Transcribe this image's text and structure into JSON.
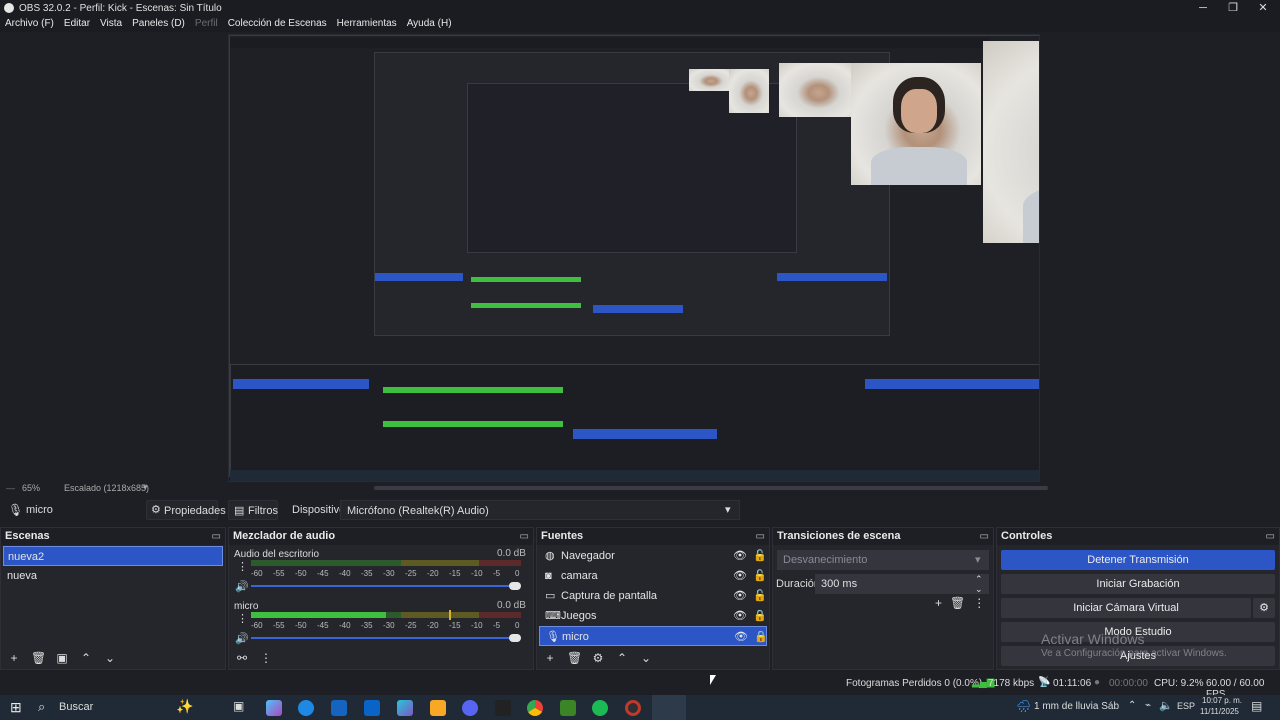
{
  "window": {
    "title": "OBS 32.0.2 - Perfil: Kick - Escenas: Sin Título",
    "controls": {
      "minimize": "─",
      "maximize": "❐",
      "close": "✕"
    }
  },
  "menu": {
    "items": [
      "Archivo (F)",
      "Editar",
      "Vista",
      "Paneles (D)",
      "Perfil",
      "Colección de Escenas",
      "Herramientas",
      "Ayuda (H)"
    ]
  },
  "scale": {
    "zoom": "65%",
    "scaled_label": "Escalado (1218x685)"
  },
  "properties_bar": {
    "source_name": "micro",
    "properties_label": "Propiedades",
    "filters_label": "Filtros",
    "device_label": "Dispositivo",
    "device_value": "Micrófono (Realtek(R) Audio)"
  },
  "scenes": {
    "header": "Escenas",
    "items": [
      "nueva2",
      "nueva"
    ],
    "selected": "nueva2"
  },
  "mixer": {
    "header": "Mezclador de audio",
    "channels": [
      {
        "name": "Audio del escritorio",
        "db": "0.0 dB",
        "level": 0.0
      },
      {
        "name": "micro",
        "db": "0.0 dB",
        "level": 0.5
      }
    ],
    "ticks": [
      "-60",
      "-55",
      "-50",
      "-45",
      "-40",
      "-35",
      "-30",
      "-25",
      "-20",
      "-15",
      "-10",
      "-5",
      "0"
    ]
  },
  "sources": {
    "header": "Fuentes",
    "items": [
      {
        "name": "Navegador",
        "icon": "globe-icon",
        "locked": false
      },
      {
        "name": "camara",
        "icon": "camera-icon",
        "locked": false
      },
      {
        "name": "Captura de pantalla",
        "icon": "monitor-icon",
        "locked": false
      },
      {
        "name": "Juegos",
        "icon": "gamepad-icon",
        "locked": true
      },
      {
        "name": "micro",
        "icon": "microphone-icon",
        "locked": true
      }
    ],
    "selected": "micro"
  },
  "transitions": {
    "header": "Transiciones de escena",
    "type": "Desvanecimiento",
    "duration_label": "Duración",
    "duration_value": "300 ms"
  },
  "controls": {
    "header": "Controles",
    "stop_stream": "Detener Transmisión",
    "start_recording": "Iniciar Grabación",
    "virtual_cam": "Iniciar Cámara Virtual",
    "studio_mode": "Modo Estudio",
    "settings": "Ajustes"
  },
  "watermark": {
    "title": "Activar Windows",
    "subtitle": "Ve a Configuración para activar Windows."
  },
  "status": {
    "dropped_frames": "Fotogramas Perdidos 0 (0.0%)",
    "bitrate": "7178 kbps",
    "stream_time": "01:11:06",
    "rec_time": "00:00:00",
    "cpu": "CPU: 9.2%",
    "fps": "60.00 / 60.00 FPS"
  },
  "taskbar": {
    "search_placeholder": "Buscar",
    "weather": "1 mm de lluvia Sáb",
    "lang": "ESP",
    "time": "10:07 p. m.",
    "date": "11/11/2025"
  },
  "colors": {
    "accent": "#2c56c6",
    "panel": "#25262c",
    "background": "#1e1f25",
    "meter_green": "#3fbf3f",
    "meter_yellow": "#b8a42a",
    "meter_red": "#a53a3a"
  }
}
